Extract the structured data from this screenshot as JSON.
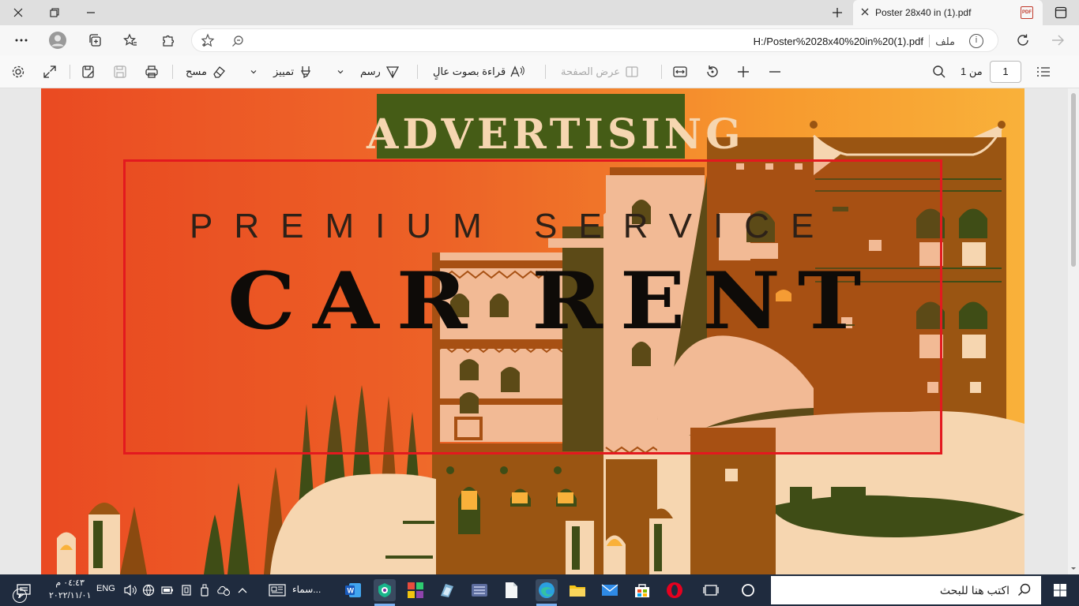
{
  "tab": {
    "title": "Poster 28x40 in (1).pdf"
  },
  "address": {
    "url": "H:/Poster%2028x40%20in%20(1).pdf",
    "file_label": "ملف"
  },
  "pdf_toolbar": {
    "erase_label": "مسح",
    "highlight_label": "تمييز",
    "draw_label": "رسم",
    "read_aloud_label": "قراءة بصوت عالٍ",
    "page_view_label": "عرض الصفحة",
    "page_number": "1",
    "page_total": "من 1"
  },
  "poster": {
    "advertising": "ADVERTISING",
    "premium": "PREMIUM SERVICE",
    "car_rent": "CAR RENT",
    "colors": {
      "banner": "#455c16",
      "frame": "#e3191f",
      "cream": "#f6d6b0",
      "brown": "#9a5512"
    }
  },
  "taskbar": {
    "time": "٠٤:٤٣ م",
    "date": "٢٠٢٢/١١/٠١",
    "lang": "ENG",
    "notif_count": "٧",
    "window_label": "سماء...",
    "search_placeholder": "اكتب هنا للبحث"
  }
}
